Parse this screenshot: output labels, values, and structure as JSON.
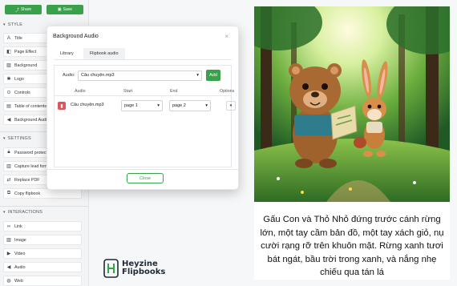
{
  "toolbar": {
    "share_label": "Share",
    "save_label": "Save"
  },
  "sidebar": {
    "style_header": "STYLE",
    "style_items": [
      {
        "label": "Title",
        "icon": "text-icon"
      },
      {
        "label": "Page Effect",
        "icon": "page-effect-icon"
      },
      {
        "label": "Background",
        "icon": "image-icon"
      },
      {
        "label": "Logo",
        "icon": "star-icon"
      },
      {
        "label": "Controls",
        "icon": "controls-icon"
      },
      {
        "label": "Table of contents",
        "icon": "book-icon"
      },
      {
        "label": "Background Audio",
        "icon": "audio-icon"
      }
    ],
    "settings_header": "SETTINGS",
    "settings_items": [
      {
        "label": "Password protect",
        "icon": "lock-icon"
      },
      {
        "label": "Capture lead form",
        "icon": "form-icon"
      },
      {
        "label": "Replace PDF",
        "icon": "replace-icon"
      },
      {
        "label": "Copy flipbook",
        "icon": "copy-icon"
      }
    ],
    "interactions_header": "INTERACTIONS",
    "interactions_items": [
      {
        "label": "Link",
        "icon": "link-icon"
      },
      {
        "label": "Image",
        "icon": "image-icon"
      },
      {
        "label": "Video",
        "icon": "video-icon"
      },
      {
        "label": "Audio",
        "icon": "audio-icon"
      },
      {
        "label": "Web",
        "icon": "web-icon"
      }
    ]
  },
  "modal": {
    "title": "Background Audio",
    "close_glyph": "×",
    "tabs": [
      "Library",
      "Flipbook audio"
    ],
    "active_tab": "Flipbook audio",
    "audio_label": "Audio:",
    "audio_value": "Câu chuyện.mp3",
    "add_label": "Add",
    "columns": [
      "Audio",
      "Start",
      "End",
      "Options"
    ],
    "row": {
      "audio": "Câu chuyện.mp3",
      "start": "page 1",
      "end": "page 2"
    },
    "close_label": "Close"
  },
  "book": {
    "caption": "Gấu Con và Thỏ Nhỏ đứng trước cánh rừng lớn, một tay cầm bản đồ, một tay xách giỏ, nụ cười rạng rỡ trên khuôn mặt. Rừng xanh tươi bát ngát, bầu trời trong xanh, và nắng nhẹ chiếu qua tán lá"
  },
  "logo": {
    "line1": "Heyzine",
    "line2": "Flipbooks"
  },
  "colors": {
    "accent_green": "#3aa14b",
    "delete_red": "#e1555a"
  }
}
